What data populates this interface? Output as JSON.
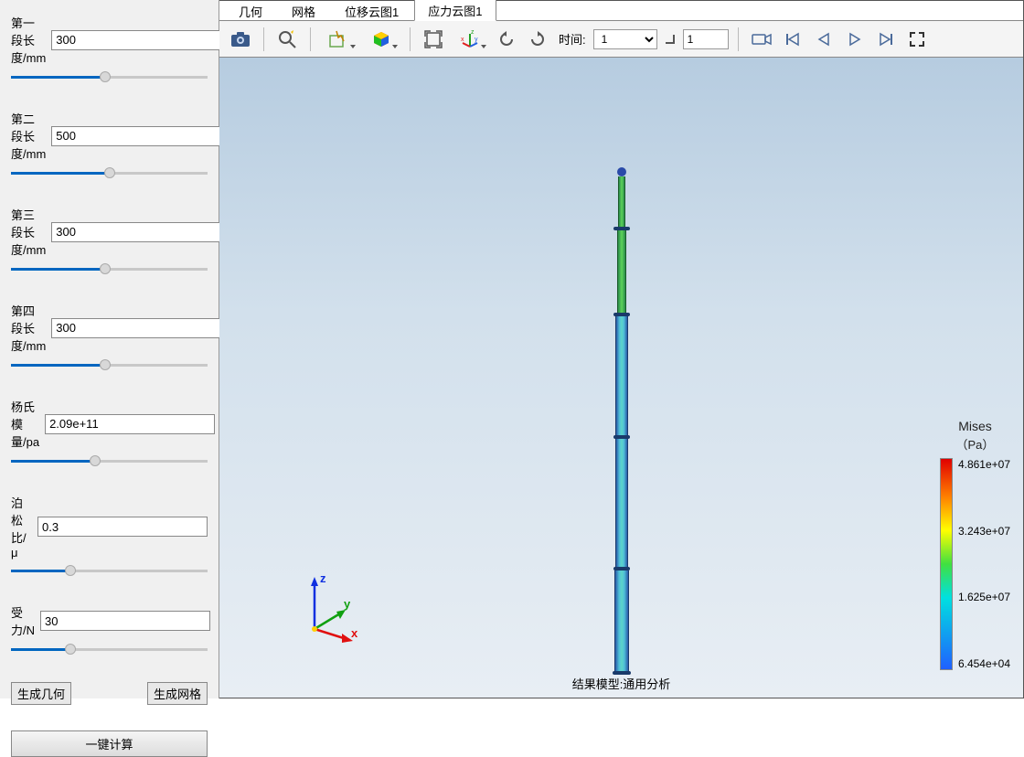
{
  "sidebar": {
    "params": [
      {
        "label": "第一段长度/mm",
        "value": "300",
        "slider_pct": 48
      },
      {
        "label": "第二段长度/mm",
        "value": "500",
        "slider_pct": 50
      },
      {
        "label": "第三段长度/mm",
        "value": "300",
        "slider_pct": 48
      },
      {
        "label": "第四段长度/mm",
        "value": "300",
        "slider_pct": 48
      },
      {
        "label": "杨氏模量/pa",
        "value": "2.09e+11",
        "slider_pct": 43
      },
      {
        "label": "泊松比/μ",
        "value": "0.3",
        "slider_pct": 30
      },
      {
        "label": "受力/N",
        "value": "30",
        "slider_pct": 30
      }
    ],
    "btn_geom": "生成几何",
    "btn_mesh": "生成网格",
    "btn_compute": "一键计算"
  },
  "tabs": [
    "几何",
    "网格",
    "位移云图1",
    "应力云图1"
  ],
  "active_tab": 3,
  "toolbar": {
    "time_label": "时间:",
    "time_value": "1",
    "frame_value": "1"
  },
  "viewport": {
    "result_label": "结果模型:通用分析",
    "axes": {
      "x": "x",
      "y": "y",
      "z": "z"
    }
  },
  "legend": {
    "title": "Mises",
    "unit": "（Pa）",
    "ticks": [
      "4.861e+07",
      "3.243e+07",
      "1.625e+07",
      "6.454e+04"
    ]
  }
}
